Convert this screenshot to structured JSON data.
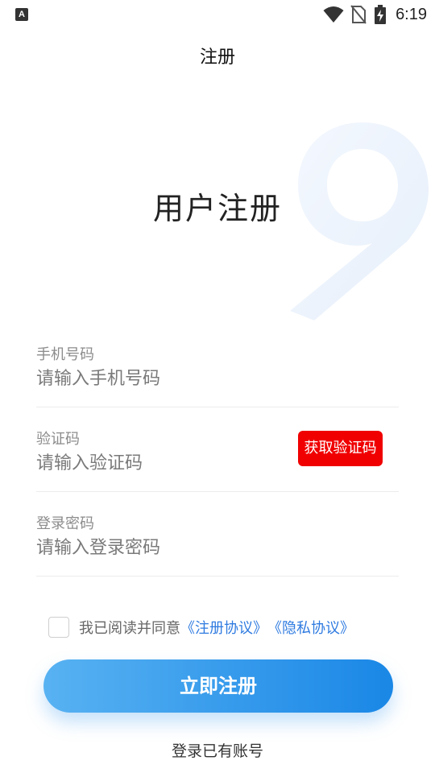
{
  "status_bar": {
    "notification_glyph": "A",
    "time": "6:19",
    "icons": [
      "wifi-icon",
      "no-sim-icon",
      "battery-charging-icon"
    ]
  },
  "header": {
    "title": "注册"
  },
  "heading": "用户注册",
  "decoration": {
    "glyph": "9",
    "color": "#eef4fc"
  },
  "form": {
    "phone": {
      "label": "手机号码",
      "placeholder": "请输入手机号码"
    },
    "code": {
      "label": "验证码",
      "placeholder": "请输入验证码",
      "button_label": "获取验证码"
    },
    "password": {
      "label": "登录密码",
      "placeholder": "请输入登录密码"
    }
  },
  "agreement": {
    "text": "我已阅读并同意",
    "link_terms": "《注册协议》",
    "link_privacy": "《隐私协议》",
    "checked": false
  },
  "actions": {
    "register_label": "立即注册",
    "login_label": "登录已有账号"
  },
  "colors": {
    "accent": "#1a87e6",
    "link": "#2f7be0",
    "code_button": "#f00000"
  }
}
